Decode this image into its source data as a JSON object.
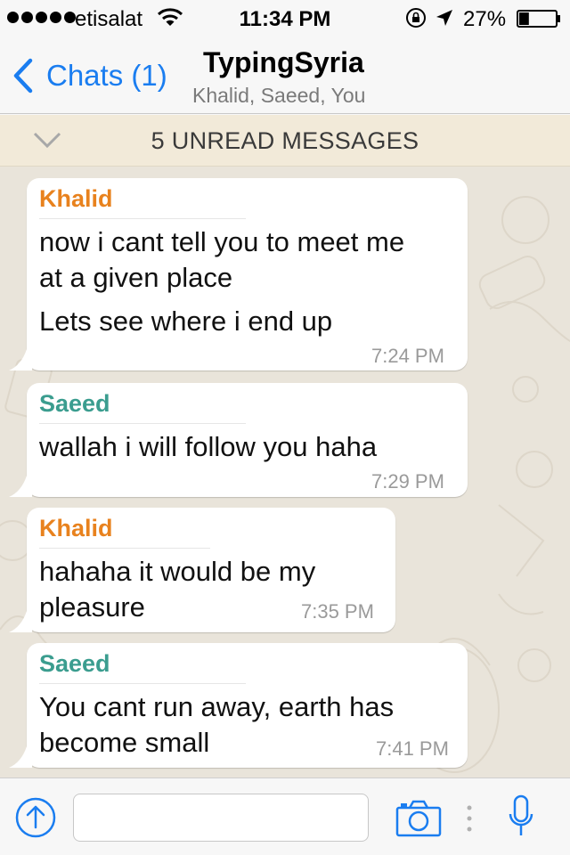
{
  "status_bar": {
    "carrier": "etisalat",
    "time": "11:34 PM",
    "battery_percent": "27%",
    "battery_level": 0.27
  },
  "nav": {
    "back_label": "Chats (1)",
    "title": "TypingSyria",
    "subtitle": "Khalid, Saeed, You"
  },
  "unread": {
    "label": "5 UNREAD MESSAGES"
  },
  "messages": [
    {
      "sender": "Khalid",
      "lines": [
        "now i cant tell you to meet me",
        "at a given place",
        "Lets see where i end up"
      ],
      "time": "7:24 PM"
    },
    {
      "sender": "Saeed",
      "lines": [
        "wallah  i will follow you haha"
      ],
      "time": "7:29 PM"
    },
    {
      "sender": "Khalid",
      "lines": [
        "hahaha it would be my",
        "pleasure"
      ],
      "time": "7:35 PM"
    },
    {
      "sender": "Saeed",
      "lines": [
        "You cant run away, earth has",
        "become small"
      ],
      "time": "7:41 PM"
    }
  ],
  "input": {
    "value": "",
    "placeholder": ""
  },
  "colors": {
    "accent": "#1a7df0",
    "khalid": "#e8821e",
    "saeed": "#3b9d8f",
    "unread_bg": "#f2ead9",
    "chat_bg": "#e9e4da"
  },
  "icons": [
    "wifi-icon",
    "rotation-lock-icon",
    "location-arrow-icon",
    "battery-icon",
    "back-chevron-icon",
    "chevron-down-icon",
    "share-upload-icon",
    "camera-icon",
    "more-dots-icon",
    "microphone-icon"
  ]
}
